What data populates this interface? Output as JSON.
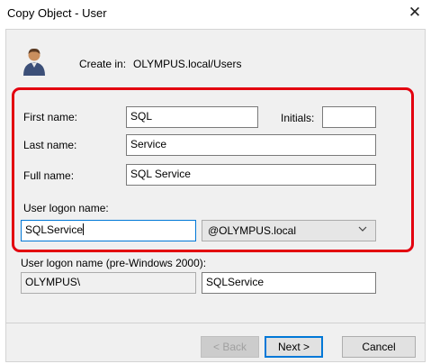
{
  "window": {
    "title": "Copy Object - User"
  },
  "header": {
    "create_in_label": "Create in:",
    "create_in_value": "OLYMPUS.local/Users"
  },
  "form": {
    "first_name_label": "First name:",
    "first_name_value": "SQL",
    "initials_label": "Initials:",
    "initials_value": "",
    "last_name_label": "Last name:",
    "last_name_value": "Service",
    "full_name_label": "Full name:",
    "full_name_value": "SQL Service",
    "logon_name_label": "User logon name:",
    "logon_name_value": "SQLService",
    "domain_select_value": "@OLYMPUS.local",
    "pre2000_label": "User logon name (pre-Windows 2000):",
    "pre2000_domain_value": "OLYMPUS\\",
    "pre2000_name_value": "SQLService"
  },
  "buttons": {
    "back_label": "< Back",
    "next_label": "Next >",
    "cancel_label": "Cancel"
  },
  "icons": {
    "user": "user-icon",
    "close": "close-icon",
    "dropdown": "chevron-down-icon"
  },
  "colors": {
    "highlight": "#e3000f",
    "focus": "#0078d7"
  }
}
